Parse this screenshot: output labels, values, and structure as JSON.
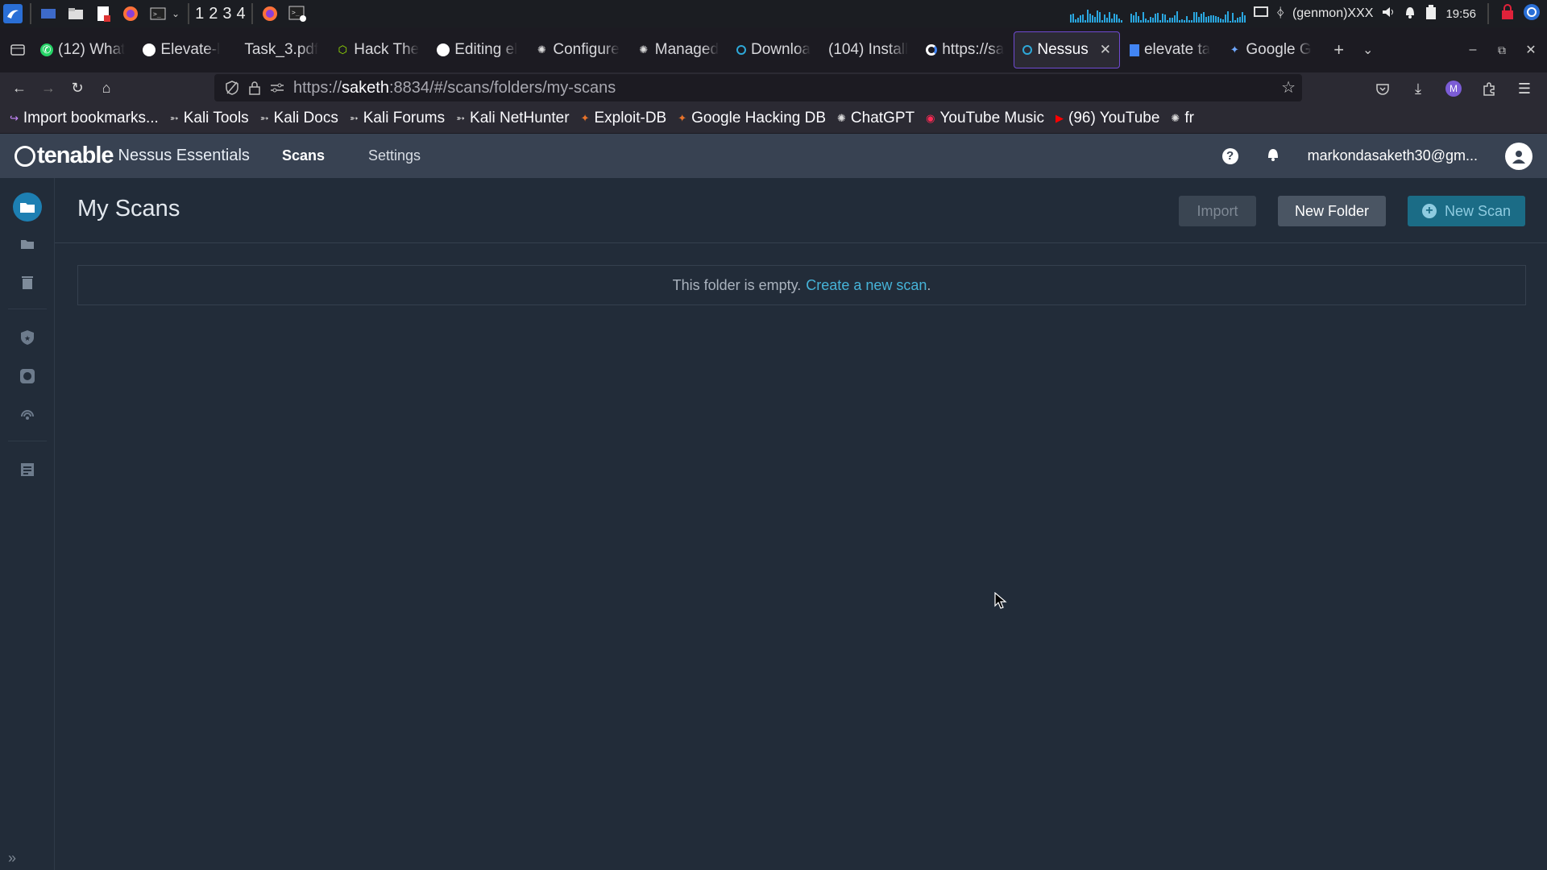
{
  "taskbar": {
    "workspaces": [
      "1",
      "2",
      "3",
      "4"
    ],
    "genmon": "(genmon)XXX",
    "clock": "19:56"
  },
  "browser": {
    "tabs": [
      {
        "label": "(12) What",
        "icon": "whatsapp-icon"
      },
      {
        "label": "Elevate-l",
        "icon": "github-icon"
      },
      {
        "label": "Task_3.pdf",
        "icon": ""
      },
      {
        "label": "Hack The",
        "icon": "hackthebox-icon"
      },
      {
        "label": "Editing el",
        "icon": "github-icon"
      },
      {
        "label": "Configure",
        "icon": "openai-icon"
      },
      {
        "label": "Managed",
        "icon": "openai-icon"
      },
      {
        "label": "Downloa",
        "icon": "nessus-icon"
      },
      {
        "label": "(104) Install",
        "icon": ""
      },
      {
        "label": "https://sa",
        "icon": "google-icon"
      },
      {
        "label": "Nessus",
        "icon": "nessus-icon",
        "active": true
      },
      {
        "label": "elevate ta",
        "icon": "docs-icon"
      },
      {
        "label": "Google G",
        "icon": "gemini-icon"
      }
    ],
    "url": {
      "scheme": "https://",
      "host": "saketh",
      "rest": ":8834/#/scans/folders/my-scans"
    },
    "bookmarks": [
      {
        "label": "Import bookmarks...",
        "icon": "import-icon"
      },
      {
        "label": "Kali Tools",
        "icon": "kali-icon"
      },
      {
        "label": "Kali Docs",
        "icon": "kali-icon"
      },
      {
        "label": "Kali Forums",
        "icon": "kali-icon"
      },
      {
        "label": "Kali NetHunter",
        "icon": "kali-icon"
      },
      {
        "label": "Exploit-DB",
        "icon": "exploitdb-icon"
      },
      {
        "label": "Google Hacking DB",
        "icon": "exploitdb-icon"
      },
      {
        "label": "ChatGPT",
        "icon": "openai-icon"
      },
      {
        "label": "YouTube Music",
        "icon": "youtube-music-icon"
      },
      {
        "label": "(96) YouTube",
        "icon": "youtube-icon"
      },
      {
        "label": "fr",
        "icon": "openai-icon"
      }
    ]
  },
  "nessus": {
    "brand": "tenable",
    "product": "Nessus Essentials",
    "nav": {
      "scans": "Scans",
      "settings": "Settings"
    },
    "user": "markondasaketh30@gm...",
    "page_title": "My Scans",
    "buttons": {
      "import": "Import",
      "new_folder": "New Folder",
      "new_scan": "New Scan"
    },
    "empty_text": "This folder is empty.",
    "empty_link": "Create a new scan",
    "empty_period": "."
  },
  "colors": {
    "header_bg": "#384252",
    "page_bg": "#222c39",
    "accent": "#46b3d8",
    "active_tab_border": "#6f4ad1"
  }
}
